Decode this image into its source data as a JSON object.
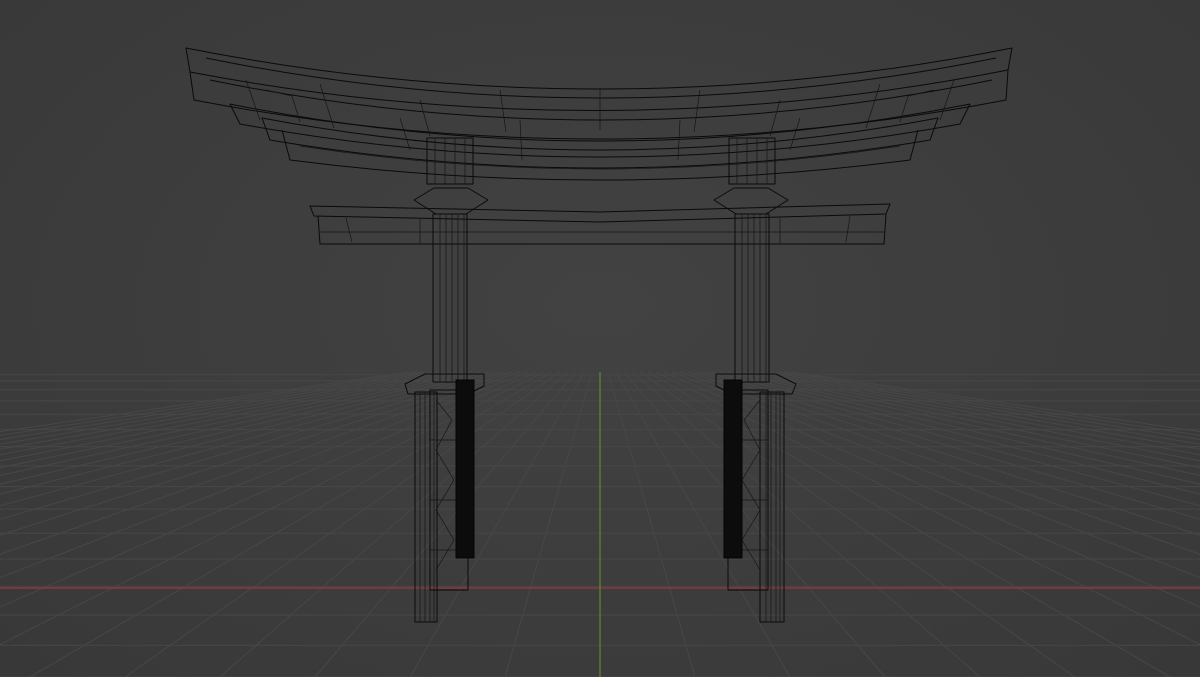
{
  "viewport": {
    "view": "3d-wireframe",
    "object": "torii-gate",
    "colors": {
      "background": "#3d3d3d",
      "grid": "#474747",
      "wire": "#0a0a0a",
      "x_axis": "#8a3a3a",
      "y_axis": "#5f8a35"
    }
  }
}
